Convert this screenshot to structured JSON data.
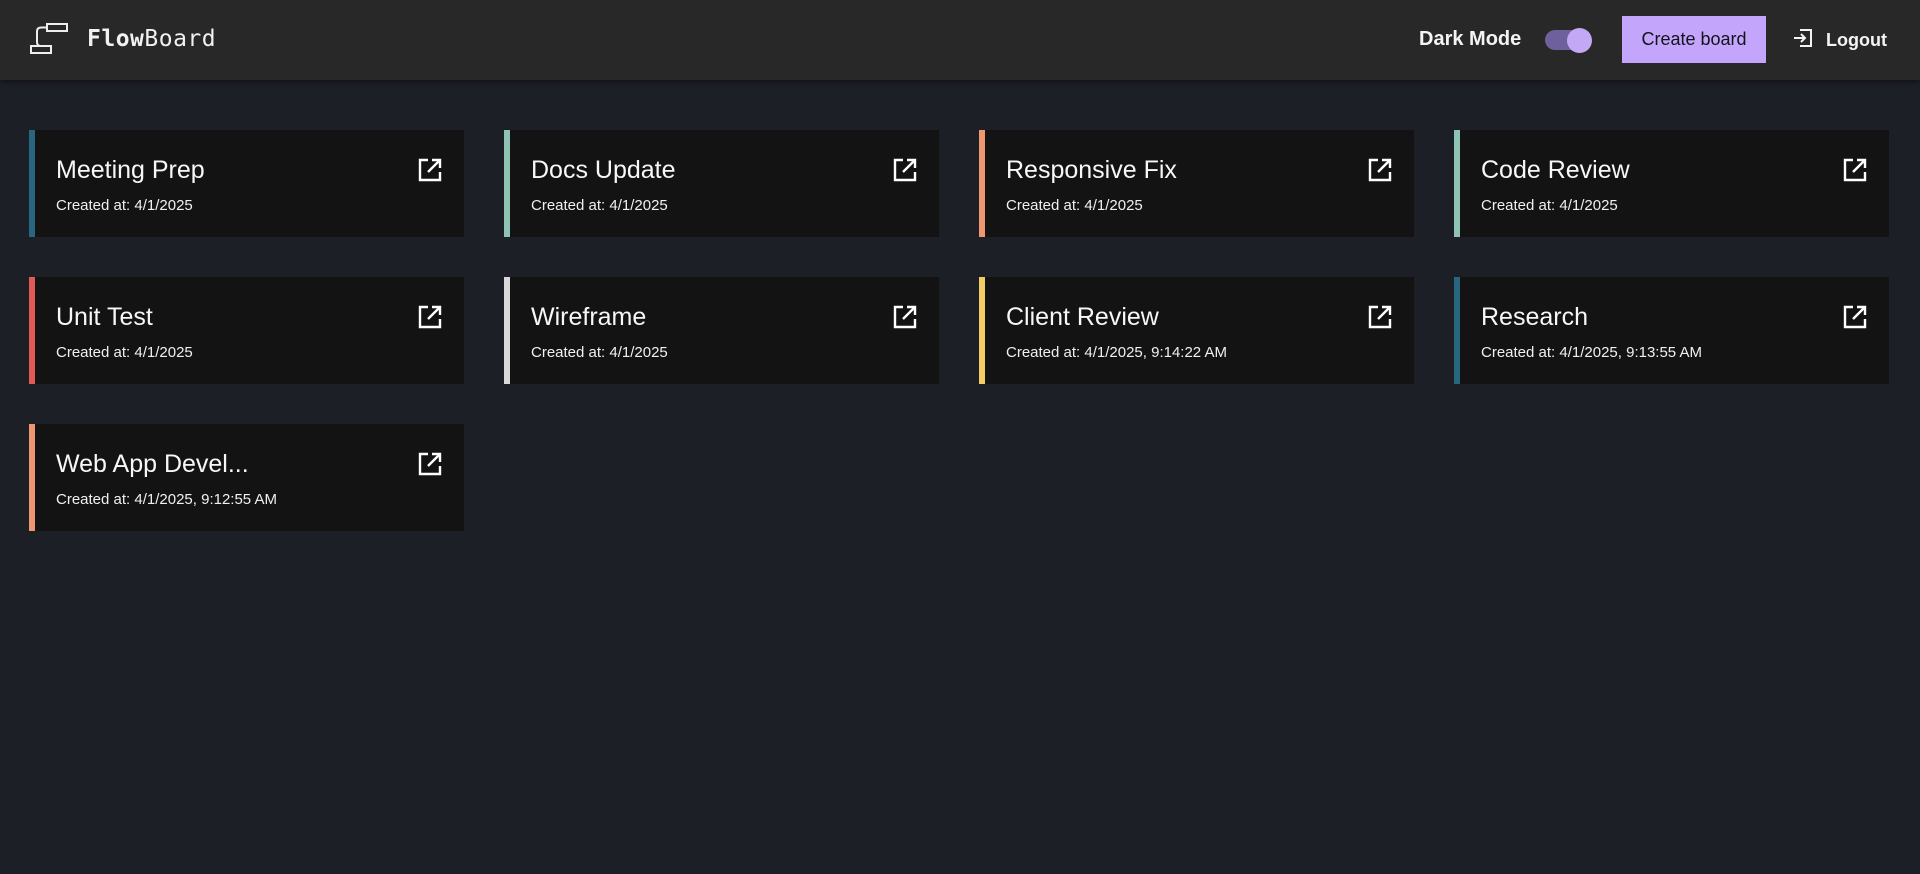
{
  "app": {
    "name_bold": "Flow",
    "name_light": "Board",
    "logo_icon": "flowboard-logo-icon"
  },
  "header": {
    "dark_mode_label": "Dark Mode",
    "dark_mode_on": true,
    "create_label": "Create board",
    "logout_label": "Logout",
    "accent_color": "#c3a6fb"
  },
  "boards": [
    {
      "title": "Meeting Prep",
      "created": "Created at: 4/1/2025",
      "color": "#28657f"
    },
    {
      "title": "Docs Update",
      "created": "Created at: 4/1/2025",
      "color": "#8ec2b3"
    },
    {
      "title": "Responsive Fix",
      "created": "Created at: 4/1/2025",
      "color": "#ee9670"
    },
    {
      "title": "Code Review",
      "created": "Created at: 4/1/2025",
      "color": "#8ec2b3"
    },
    {
      "title": "Unit Test",
      "created": "Created at: 4/1/2025",
      "color": "#e05a55"
    },
    {
      "title": "Wireframe",
      "created": "Created at: 4/1/2025",
      "color": "#d9d9d9"
    },
    {
      "title": "Client Review",
      "created": "Created at: 4/1/2025, 9:14:22 AM",
      "color": "#f3cd63"
    },
    {
      "title": "Research",
      "created": "Created at: 4/1/2025, 9:13:55 AM",
      "color": "#28657f"
    },
    {
      "title": "Web App Devel...",
      "created": "Created at: 4/1/2025, 9:12:55 AM",
      "color": "#ee9670"
    }
  ]
}
